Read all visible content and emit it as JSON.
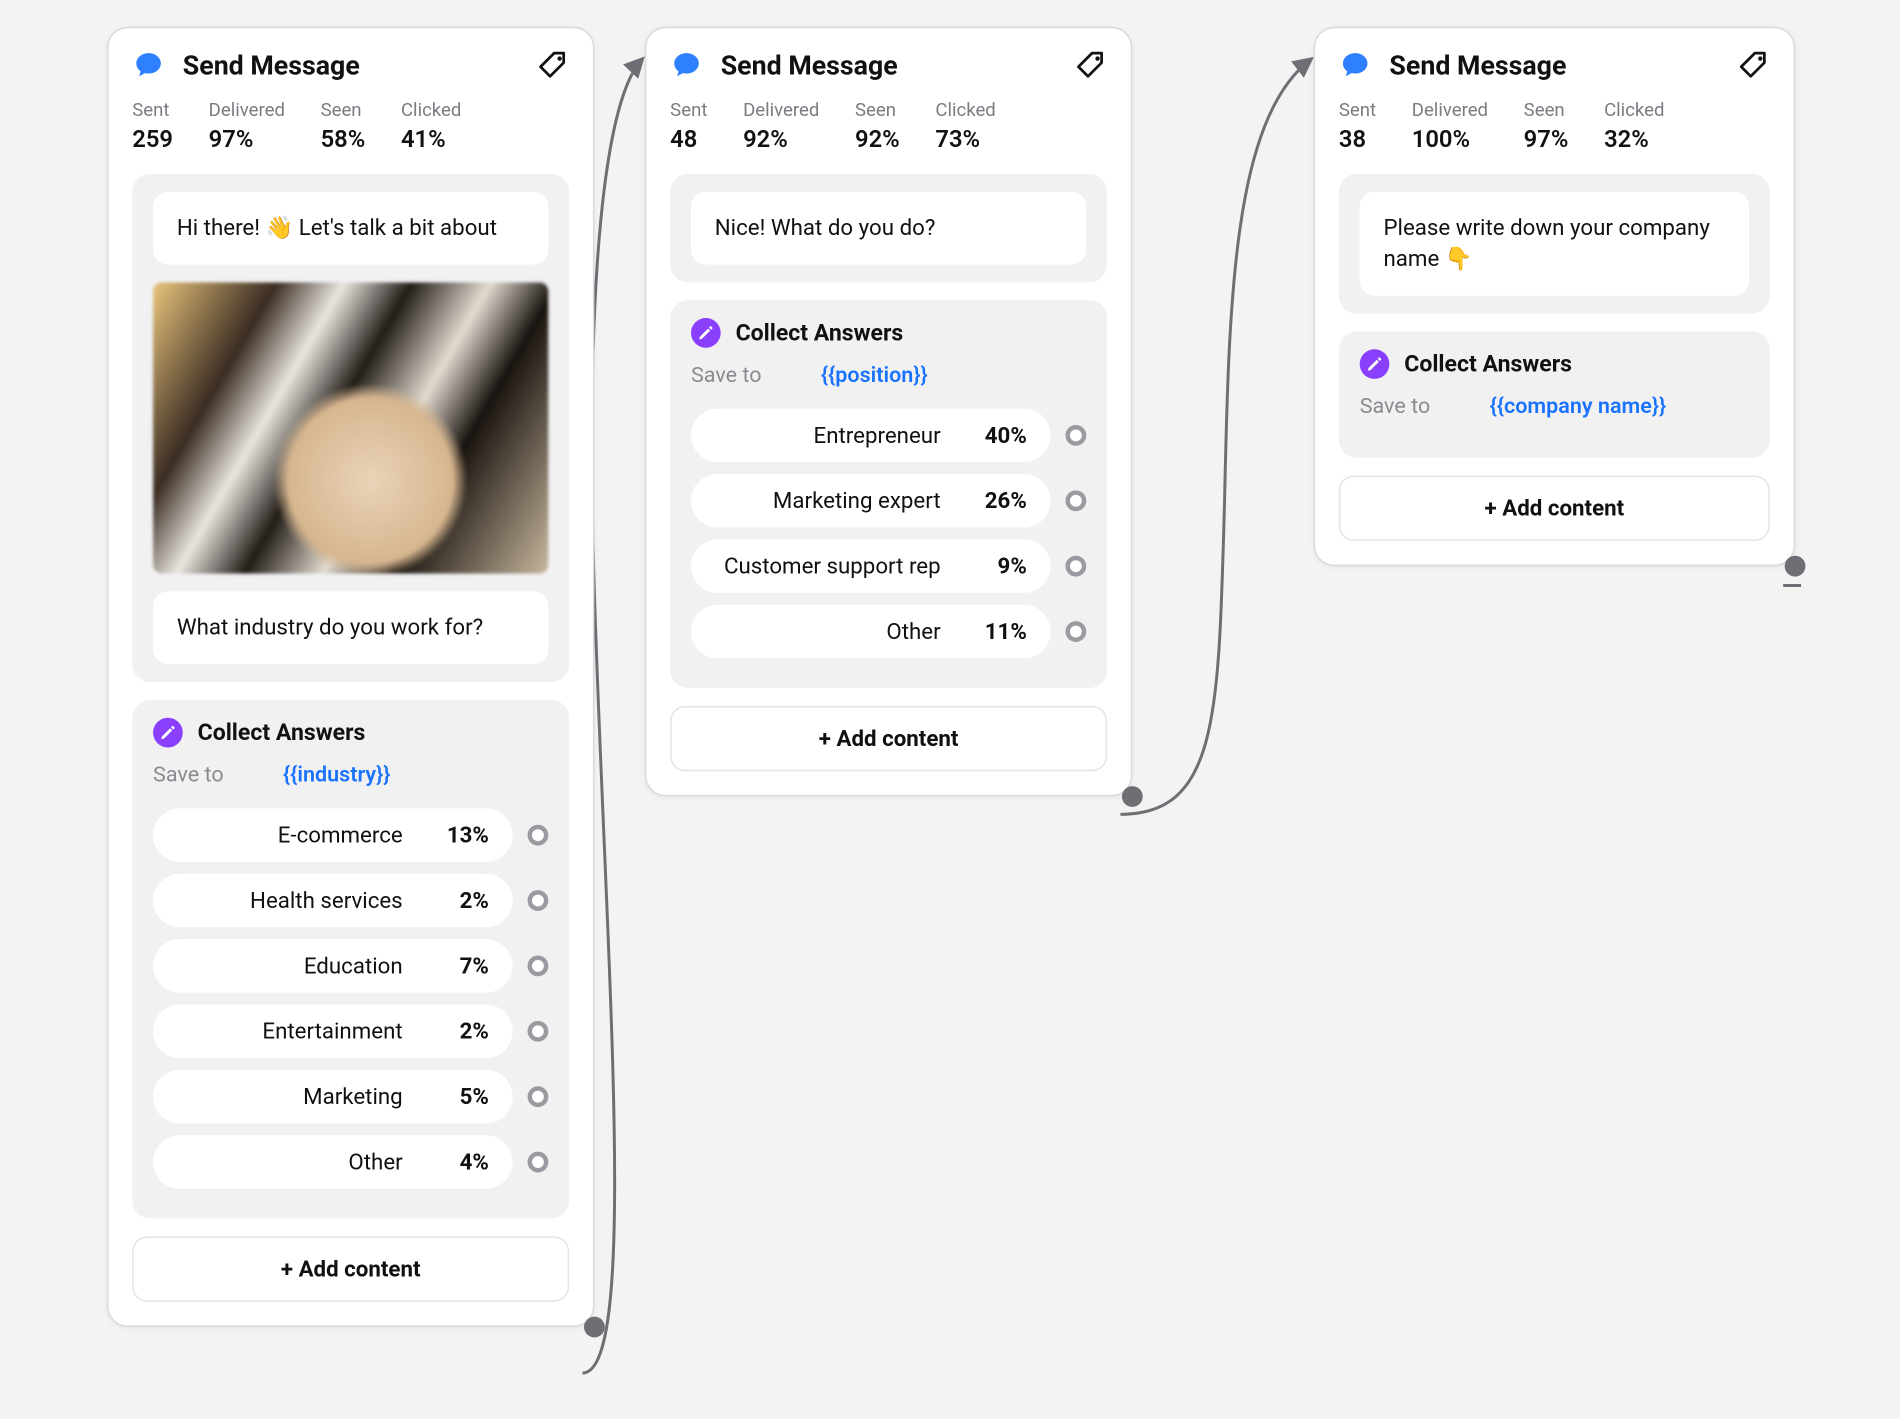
{
  "common": {
    "send_message_title": "Send Message",
    "stat_labels": {
      "sent": "Sent",
      "delivered": "Delivered",
      "seen": "Seen",
      "clicked": "Clicked"
    },
    "collect_answers_title": "Collect Answers",
    "save_to_label": "Save to",
    "add_content_label": "+ Add content"
  },
  "cards": [
    {
      "stats": {
        "sent": "259",
        "delivered": "97%",
        "seen": "58%",
        "clicked": "41%"
      },
      "messages": [
        {
          "text": "Hi there! 👋 Let's talk a bit about"
        },
        {
          "image": true
        },
        {
          "text": "What industry do you work for?"
        }
      ],
      "collect": {
        "save_to_var": "{{industry}}",
        "answers": [
          {
            "label": "E-commerce",
            "pct": "13%"
          },
          {
            "label": "Health services",
            "pct": "2%"
          },
          {
            "label": "Education",
            "pct": "7%"
          },
          {
            "label": "Entertainment",
            "pct": "2%"
          },
          {
            "label": "Marketing",
            "pct": "5%"
          },
          {
            "label": "Other",
            "pct": "4%"
          }
        ]
      }
    },
    {
      "stats": {
        "sent": "48",
        "delivered": "92%",
        "seen": "92%",
        "clicked": "73%"
      },
      "messages": [
        {
          "text": "Nice! What do you do?"
        }
      ],
      "collect": {
        "save_to_var": "{{position}}",
        "answers": [
          {
            "label": "Entrepreneur",
            "pct": "40%"
          },
          {
            "label": "Marketing expert",
            "pct": "26%"
          },
          {
            "label": "Customer support rep",
            "pct": "9%"
          },
          {
            "label": "Other",
            "pct": "11%"
          }
        ]
      }
    },
    {
      "stats": {
        "sent": "38",
        "delivered": "100%",
        "seen": "97%",
        "clicked": "32%"
      },
      "messages": [
        {
          "text": "Please write down your company name 👇"
        }
      ],
      "collect": {
        "save_to_var": "{{company name}}",
        "answers": []
      }
    }
  ]
}
